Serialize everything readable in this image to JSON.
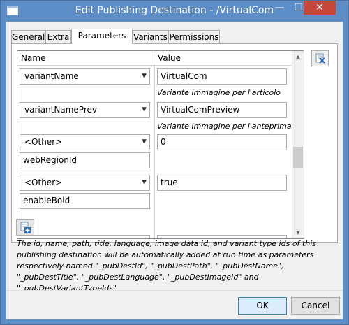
{
  "window": {
    "title": "Edit Publishing Destination - /VirtualCom",
    "minimize": "—",
    "maximize": "☐",
    "close": "✕"
  },
  "tabs": [
    {
      "label": "General"
    },
    {
      "label": "Extra"
    },
    {
      "label": "Parameters"
    },
    {
      "label": "Variants"
    },
    {
      "label": "Permissions"
    }
  ],
  "grid": {
    "col_name": "Name",
    "col_value": "Value",
    "rows": [
      {
        "name": "variantName",
        "value": "VirtualCom",
        "hint": "Variante immagine per l'articolo"
      },
      {
        "name": "variantNamePrev",
        "value": "VirtualComPreview",
        "hint": "Variante immagine per l'anteprima"
      },
      {
        "name": "<Other>",
        "custom": "webRegionId",
        "value": "0"
      },
      {
        "name": "<Other>",
        "custom": "enableBold",
        "value": "true"
      }
    ]
  },
  "note": "The id, name, path, title, language, image data id, and variant type ids of this publishing destination will be automatically added at run time as parameters respectively named \"_pubDestId\", \"_pubDestPath\", \"_pubDestName\", \"_pubDestTitle\", \"_pubDestLanguage\", \"_pubDestImageId\" and \"_pubDestVariantTypeIds\"",
  "buttons": {
    "ok": "OK",
    "cancel": "Cancel"
  }
}
